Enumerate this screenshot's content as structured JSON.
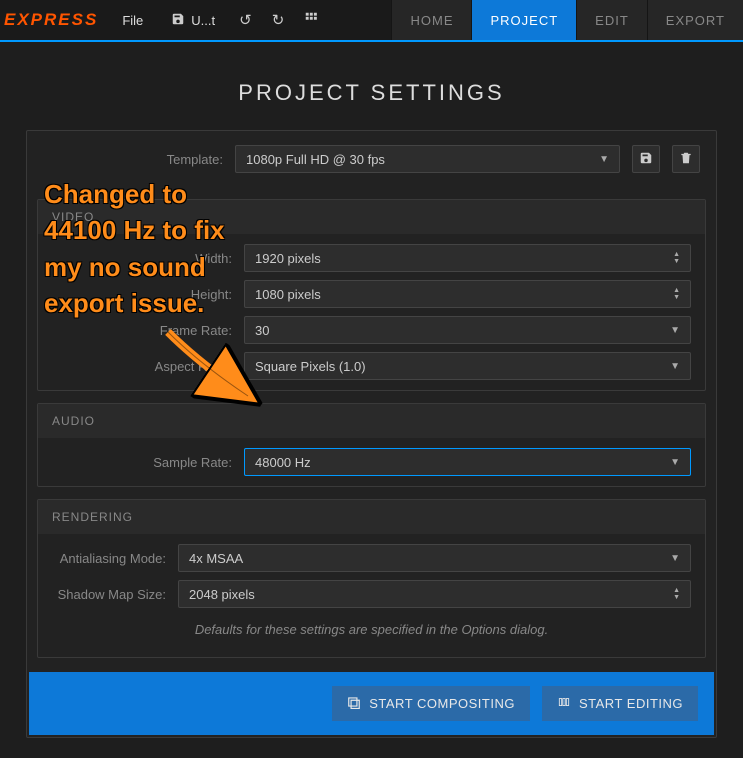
{
  "logo": "EXPRESS",
  "menu": {
    "file_label": "File",
    "save_label": "U...t"
  },
  "tabs": {
    "home": "HOME",
    "project": "PROJECT",
    "edit": "EDIT",
    "export": "EXPORT"
  },
  "title": "PROJECT SETTINGS",
  "template": {
    "label": "Template:",
    "value": "1080p Full HD @ 30 fps"
  },
  "video": {
    "header": "VIDEO",
    "width_label": "Width:",
    "width_value": "1920 pixels",
    "height_label": "Height:",
    "height_value": "1080 pixels",
    "framerate_label": "Frame Rate:",
    "framerate_value": "30",
    "aspect_label": "Aspect Ratio:",
    "aspect_value": "Square Pixels (1.0)"
  },
  "audio": {
    "header": "AUDIO",
    "sample_label": "Sample Rate:",
    "sample_value": "48000 Hz"
  },
  "rendering": {
    "header": "RENDERING",
    "aa_label": "Antialiasing Mode:",
    "aa_value": "4x MSAA",
    "shadow_label": "Shadow Map Size:",
    "shadow_value": "2048 pixels",
    "hint": "Defaults for these settings are specified in the Options dialog."
  },
  "actions": {
    "compositing": "START COMPOSITING",
    "editing": "START EDITING"
  },
  "annotation": {
    "text": "Changed to 44100 Hz to fix my no sound export issue."
  }
}
